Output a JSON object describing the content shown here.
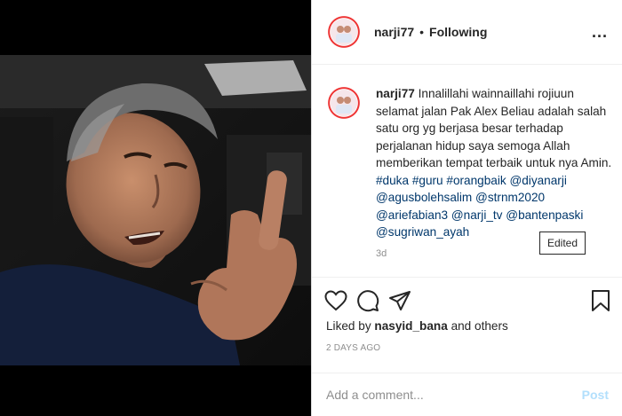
{
  "header": {
    "username": "narji77",
    "separator": "•",
    "following_label": "Following",
    "more_icon": "..."
  },
  "caption": {
    "username": "narji77",
    "text": "Innalillahi wainnaillahi rojiuun selamat jalan Pak Alex Beliau adalah salah satu org yg berjasa besar terhadap perjalanan hidup saya semoga Allah memberikan tempat terbaik untuk nya Amin.",
    "tags": [
      "#duka",
      "#guru",
      "#orangbaik",
      "@diyanarji",
      "@agusbolehsalim",
      "@strnm2020",
      "@ariefabian3",
      "@narji_tv",
      "@bantenpaski",
      "@sugriwan_ayah"
    ],
    "time": "3d"
  },
  "tooltip": {
    "label": "Edited"
  },
  "actions": {
    "like_icon": "heart-icon",
    "comment_icon": "comment-icon",
    "share_icon": "share-icon",
    "save_icon": "bookmark-icon"
  },
  "likes": {
    "prefix": "Liked by",
    "user": "nasyid_bana",
    "suffix": "and others"
  },
  "date": "2 DAYS AGO",
  "comment": {
    "placeholder": "Add a comment...",
    "post_label": "Post"
  },
  "colors": {
    "link": "#00376b",
    "muted": "#8e8e8e",
    "post_disabled": "#b2dffc",
    "ring": "#e33333"
  }
}
